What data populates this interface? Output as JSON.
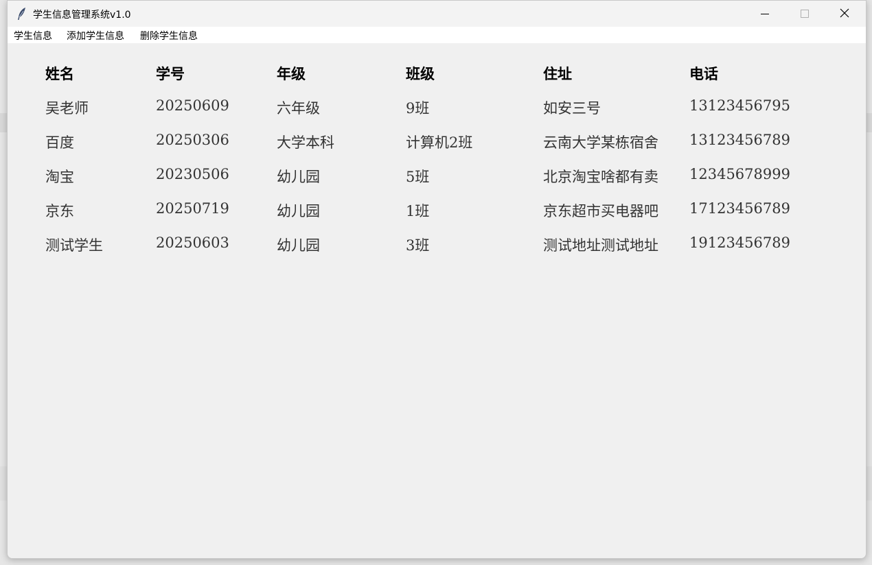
{
  "window": {
    "title": "学生信息管理系统v1.0"
  },
  "menu": [
    {
      "label": "学生信息"
    },
    {
      "label": "添加学生信息"
    },
    {
      "label": "删除学生信息"
    }
  ],
  "table": {
    "headers": [
      "姓名",
      "学号",
      "年级",
      "班级",
      "住址",
      "电话"
    ],
    "rows": [
      [
        "吴老师",
        "20250609",
        "六年级",
        "9班",
        "如安三号",
        "13123456795"
      ],
      [
        "百度",
        "20250306",
        "大学本科",
        "计算机2班",
        "云南大学某栋宿舍",
        "13123456789"
      ],
      [
        "淘宝",
        "20230506",
        "幼儿园",
        "5班",
        "北京淘宝啥都有卖",
        "12345678999"
      ],
      [
        "京东",
        "20250719",
        "幼儿园",
        "1班",
        "京东超市买电器吧",
        "17123456789"
      ],
      [
        "测试学生",
        "20250603",
        "幼儿园",
        "3班",
        "测试地址测试地址",
        "19123456789"
      ]
    ]
  },
  "icons": {
    "app": "feather-icon",
    "minimize": "minimize-icon",
    "maximize": "maximize-icon",
    "close": "close-icon"
  }
}
